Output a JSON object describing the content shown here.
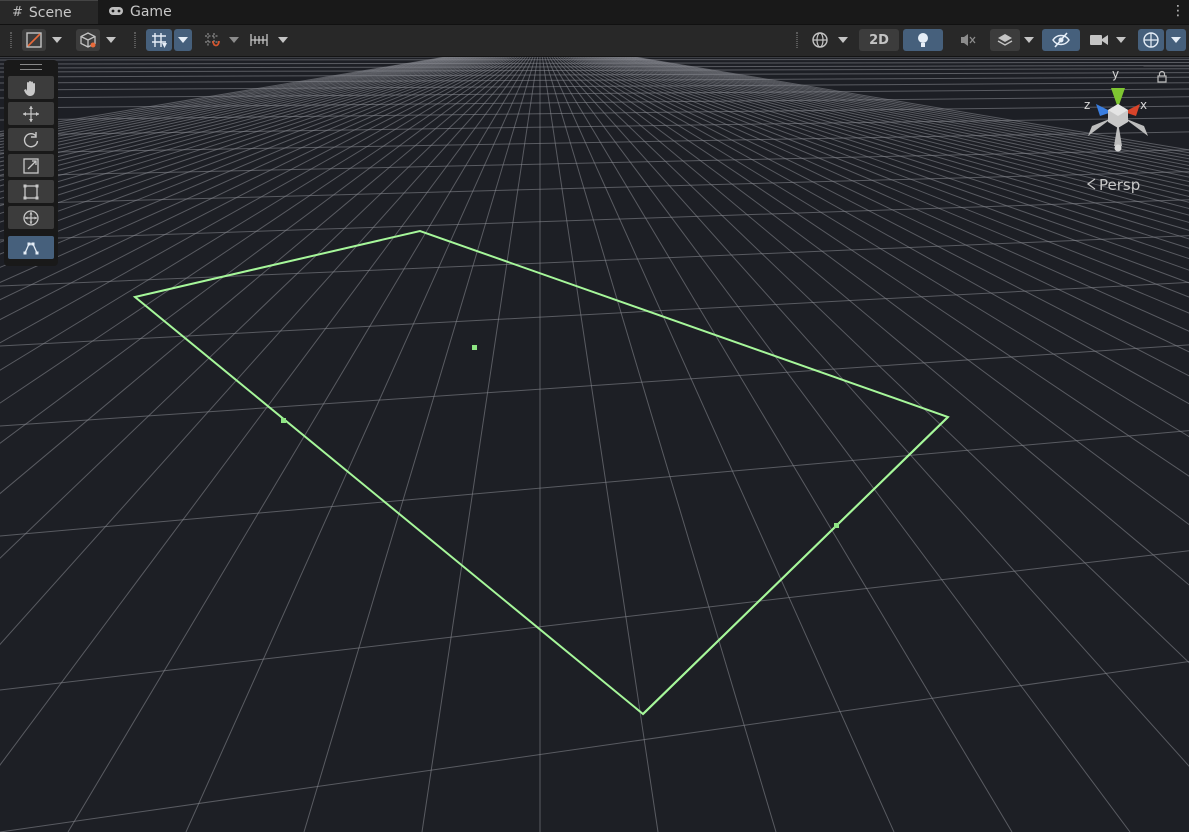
{
  "tabs": [
    {
      "label": "Scene",
      "icon": "hash-icon"
    },
    {
      "label": "Game",
      "icon": "gamepad-icon"
    }
  ],
  "toolbar": {
    "two_d_label": "2D"
  },
  "tools": [
    {
      "name": "hand-tool",
      "icon": "hand-icon"
    },
    {
      "name": "move-tool",
      "icon": "move-icon"
    },
    {
      "name": "rotate-tool",
      "icon": "rotate-icon"
    },
    {
      "name": "scale-tool",
      "icon": "scale-icon"
    },
    {
      "name": "rect-tool",
      "icon": "rect-icon"
    },
    {
      "name": "transform-tool",
      "icon": "transform-icon"
    },
    {
      "name": "custom-editor-tool",
      "icon": "path-edit-icon",
      "active": true
    }
  ],
  "gizmo": {
    "axes": {
      "x": "x",
      "y": "y",
      "z": "z"
    },
    "projection_label": "Persp"
  },
  "colors": {
    "background": "#1d1f25",
    "grid": "#8a8d93",
    "selection_outline": "#a6f79a",
    "active_button": "#46607c",
    "axis_x": "#d8442a",
    "axis_y": "#7ec631",
    "axis_z": "#3a7ee0"
  }
}
